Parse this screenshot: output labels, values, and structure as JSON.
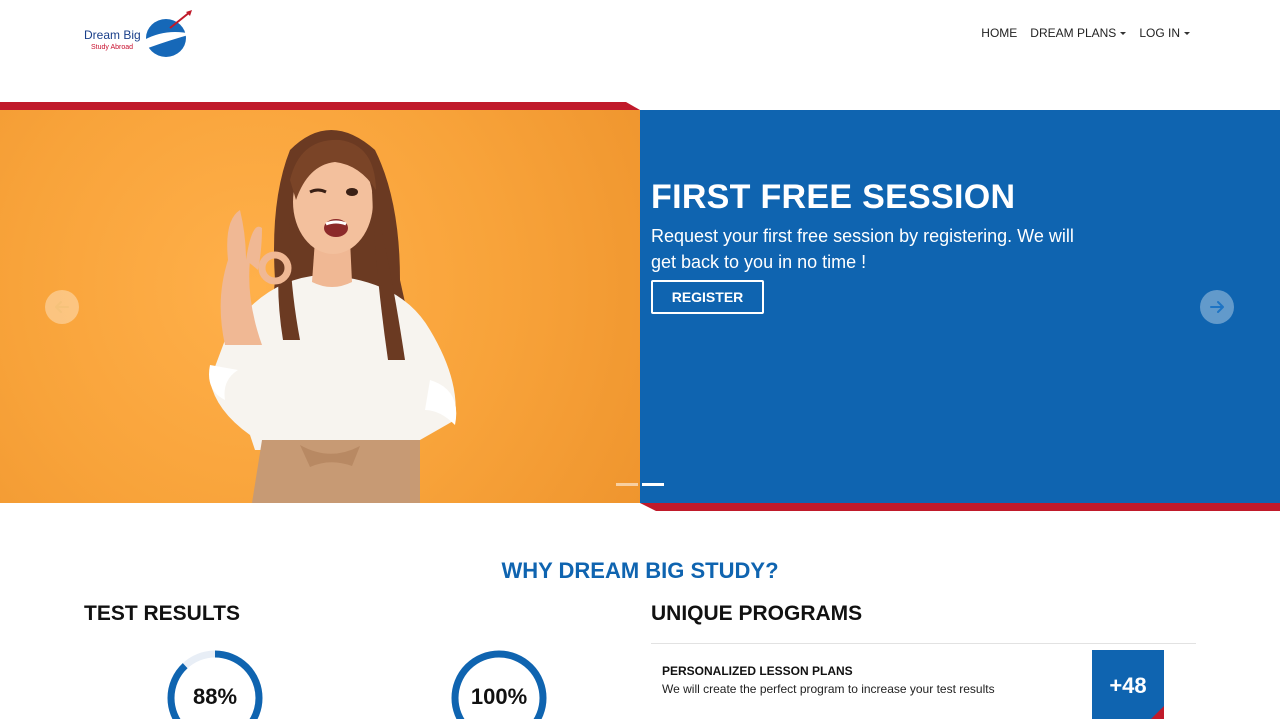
{
  "brand": {
    "name": "Dream Big",
    "tagline": "Study Abroad",
    "primary_color": "#0f64b0",
    "accent_color": "#c01a2a"
  },
  "nav": {
    "items": [
      {
        "label": "HOME",
        "dropdown": false
      },
      {
        "label": "DREAM PLANS",
        "dropdown": true
      },
      {
        "label": "LOG IN",
        "dropdown": true
      }
    ]
  },
  "hero": {
    "title": "FIRST FREE SESSION",
    "text": "Request your first free session by registering. We will get back to you in no time !",
    "button_label": "REGISTER",
    "prev_icon": "arrow-left-icon",
    "next_icon": "arrow-right-icon",
    "slides_count": 2,
    "active_slide": 2
  },
  "why": {
    "title": "WHY DREAM BIG STUDY?"
  },
  "test_results": {
    "title": "TEST RESULTS",
    "gauges": [
      {
        "label": "88%",
        "value": 0.88
      },
      {
        "label": "100%",
        "value": 1.0
      }
    ]
  },
  "unique_programs": {
    "title": "UNIQUE PROGRAMS",
    "items": [
      {
        "title": "PERSONALIZED LESSON PLANS",
        "description": "We will create the perfect program to increase your test results",
        "badge": "+48"
      }
    ]
  }
}
